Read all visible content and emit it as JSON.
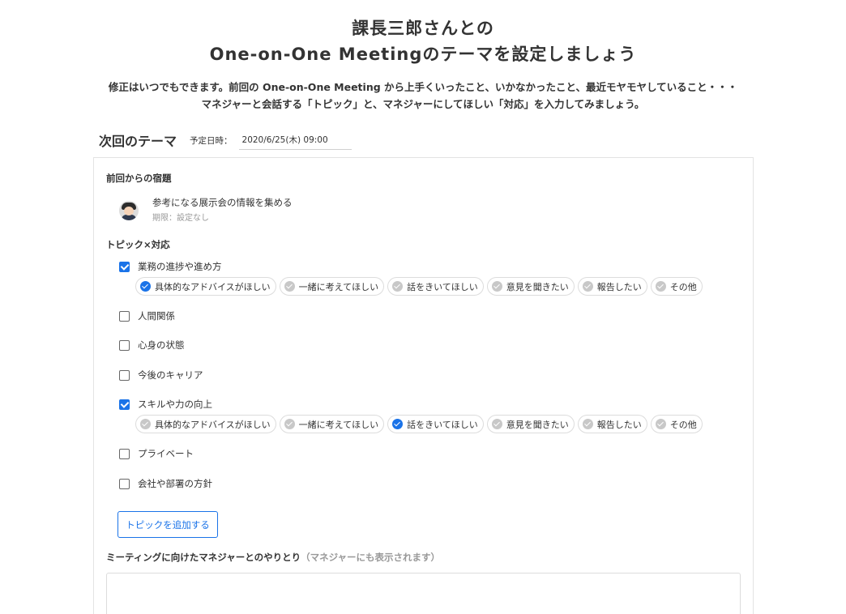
{
  "page": {
    "title_line1": "課長三郎さんとの",
    "title_line2": "One-on-One Meetingのテーマを設定しましょう",
    "description_line1": "修正はいつでもできます。前回の One-on-One Meeting から上手くいったこと、いかなかったこと、最近モヤモヤしていること・・・",
    "description_line2": "マネジャーと会話する「トピック」と、マネジャーにしてほしい「対応」を入力してみましょう。"
  },
  "next_theme": {
    "title": "次回のテーマ",
    "schedule_label": "予定日時：",
    "schedule_value": "2020/6/25(木) 09:00"
  },
  "homework": {
    "heading": "前回からの宿題",
    "item_title": "参考になる展示会の情報を集める",
    "item_due": "期限：設定なし"
  },
  "topics_section": {
    "heading": "トピック×対応",
    "topics": [
      {
        "label": "業務の進捗や進め方",
        "checked": true,
        "responses": [
          {
            "label": "具体的なアドバイスがほしい",
            "selected": true
          },
          {
            "label": "一緒に考えてほしい",
            "selected": false
          },
          {
            "label": "話をきいてほしい",
            "selected": false
          },
          {
            "label": "意見を聞きたい",
            "selected": false
          },
          {
            "label": "報告したい",
            "selected": false
          },
          {
            "label": "その他",
            "selected": false
          }
        ]
      },
      {
        "label": "人間関係",
        "checked": false
      },
      {
        "label": "心身の状態",
        "checked": false
      },
      {
        "label": "今後のキャリア",
        "checked": false
      },
      {
        "label": "スキルや力の向上",
        "checked": true,
        "responses": [
          {
            "label": "具体的なアドバイスがほしい",
            "selected": false
          },
          {
            "label": "一緒に考えてほしい",
            "selected": false
          },
          {
            "label": "話をきいてほしい",
            "selected": true
          },
          {
            "label": "意見を聞きたい",
            "selected": false
          },
          {
            "label": "報告したい",
            "selected": false
          },
          {
            "label": "その他",
            "selected": false
          }
        ]
      },
      {
        "label": "プライベート",
        "checked": false
      },
      {
        "label": "会社や部署の方針",
        "checked": false
      }
    ],
    "add_topic_label": "トピックを追加する"
  },
  "messages": {
    "label": "ミーティングに向けたマネジャーとのやりとり",
    "note": "（マネジャーにも表示されます）",
    "value": ""
  },
  "colors": {
    "accent": "#1a73e8",
    "chip_inactive": "#c8c8c8",
    "text": "#333333",
    "muted": "#999999"
  }
}
